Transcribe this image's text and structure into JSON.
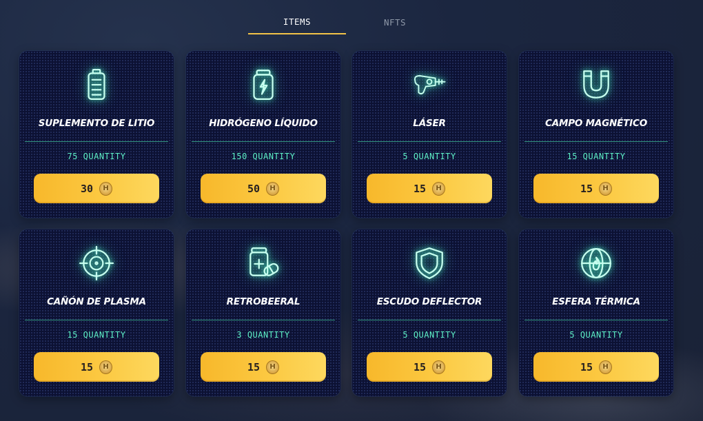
{
  "tabs": [
    {
      "label": "ITEMS",
      "active": true
    },
    {
      "label": "NFTS",
      "active": false
    }
  ],
  "colors": {
    "accent": "#f3c347",
    "neon": "#5ef0c7",
    "card_bg": "#0c1133",
    "button": "#fcc942"
  },
  "currency_icon": "hex-coin-icon",
  "coin_glyph": "H",
  "items": [
    {
      "name": "SUPLEMENTO DE LITIO",
      "quantity": "75 QUANTITY",
      "price": "30",
      "icon": "battery-icon"
    },
    {
      "name": "HIDRÓGENO LÍQUIDO",
      "quantity": "150 QUANTITY",
      "price": "50",
      "icon": "energy-jar-icon"
    },
    {
      "name": "LÁSER",
      "quantity": "5 QUANTITY",
      "price": "15",
      "icon": "ray-gun-icon"
    },
    {
      "name": "CAMPO MAGNÉTICO",
      "quantity": "15 QUANTITY",
      "price": "15",
      "icon": "magnet-icon"
    },
    {
      "name": "CAÑÓN DE PLASMA",
      "quantity": "15 QUANTITY",
      "price": "15",
      "icon": "crosshair-icon"
    },
    {
      "name": "RETROBEERAL",
      "quantity": "3 QUANTITY",
      "price": "15",
      "icon": "medicine-icon"
    },
    {
      "name": "ESCUDO DEFLECTOR",
      "quantity": "5 QUANTITY",
      "price": "15",
      "icon": "shield-icon"
    },
    {
      "name": "ESFERA TÉRMICA",
      "quantity": "5 QUANTITY",
      "price": "15",
      "icon": "fire-globe-icon"
    }
  ]
}
